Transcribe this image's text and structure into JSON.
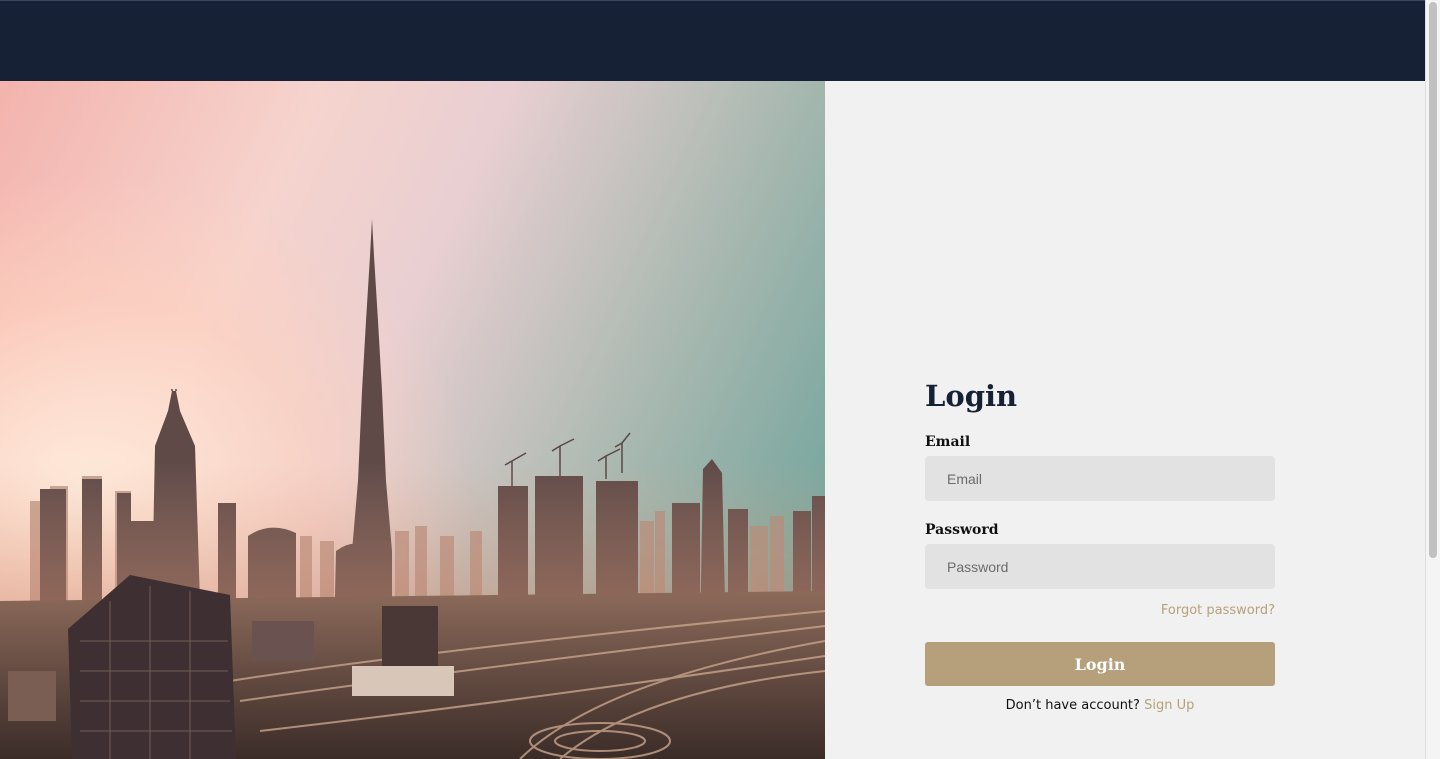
{
  "hero": {
    "image_alt": "Dubai skyline"
  },
  "login": {
    "title": "Login",
    "email_label": "Email",
    "email_placeholder": "Email",
    "email_value": "",
    "password_label": "Password",
    "password_placeholder": "Password",
    "password_value": "",
    "forgot_password": "Forgot password?",
    "submit_label": "Login",
    "signup_prompt": "Don’t have account?",
    "signup_link": "Sign Up"
  },
  "colors": {
    "navbar": "#172136",
    "accent": "#b5a07b",
    "panel_background": "#f1f1f2",
    "input_background": "#e2e2e2"
  }
}
